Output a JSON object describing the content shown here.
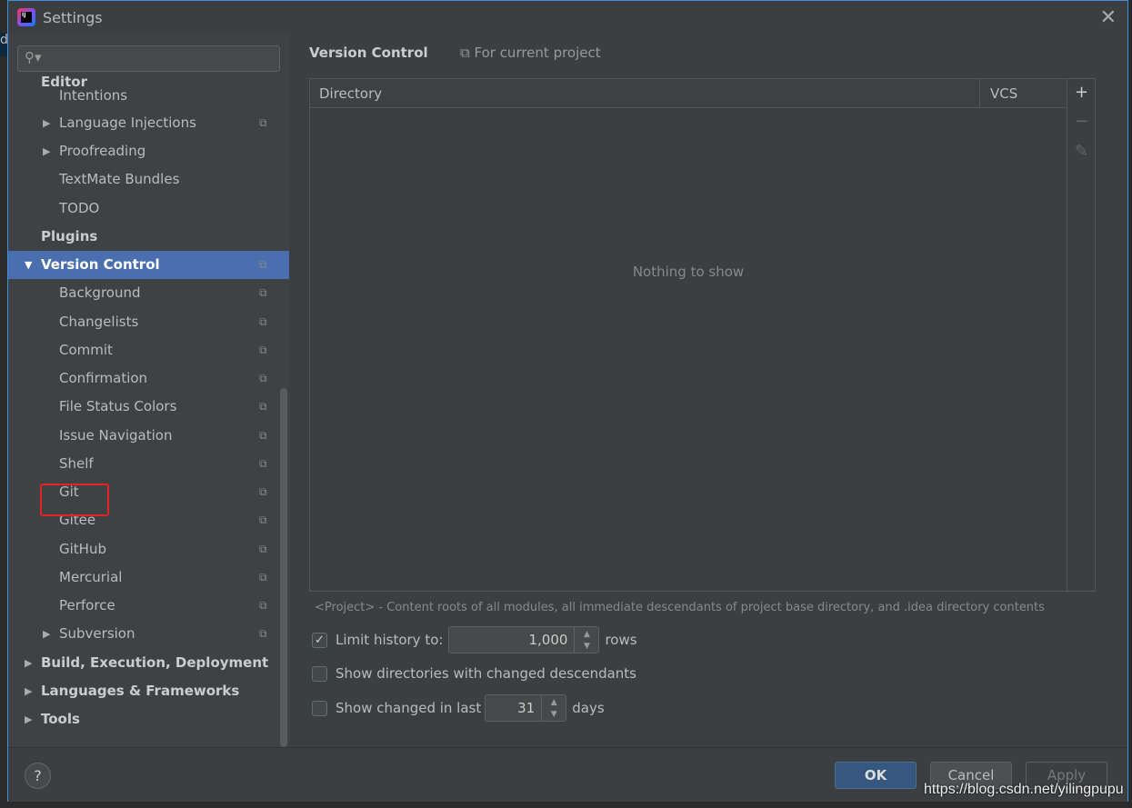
{
  "window": {
    "title": "Settings",
    "bg_partial": "d"
  },
  "sidebar": {
    "search_placeholder": "",
    "items": [
      {
        "label": "Editor",
        "level": 0,
        "bold": true
      },
      {
        "label": "Intentions",
        "level": 1
      },
      {
        "label": "Language Injections",
        "level": 1,
        "arrow": "▶",
        "copy": true
      },
      {
        "label": "Proofreading",
        "level": 1,
        "arrow": "▶"
      },
      {
        "label": "TextMate Bundles",
        "level": 1
      },
      {
        "label": "TODO",
        "level": 1
      },
      {
        "label": "Plugins",
        "level": 0,
        "bold": true
      },
      {
        "label": "Version Control",
        "level": 0,
        "bold": true,
        "arrow": "▼",
        "copy": true,
        "selected": true
      },
      {
        "label": "Background",
        "level": 1,
        "copy": true
      },
      {
        "label": "Changelists",
        "level": 1,
        "copy": true
      },
      {
        "label": "Commit",
        "level": 1,
        "copy": true
      },
      {
        "label": "Confirmation",
        "level": 1,
        "copy": true
      },
      {
        "label": "File Status Colors",
        "level": 1,
        "copy": true
      },
      {
        "label": "Issue Navigation",
        "level": 1,
        "copy": true
      },
      {
        "label": "Shelf",
        "level": 1,
        "copy": true
      },
      {
        "label": "Git",
        "level": 1,
        "copy": true
      },
      {
        "label": "Gitee",
        "level": 1,
        "copy": true,
        "highlighted": true
      },
      {
        "label": "GitHub",
        "level": 1,
        "copy": true
      },
      {
        "label": "Mercurial",
        "level": 1,
        "copy": true
      },
      {
        "label": "Perforce",
        "level": 1,
        "copy": true
      },
      {
        "label": "Subversion",
        "level": 1,
        "arrow": "▶",
        "copy": true
      },
      {
        "label": "Build, Execution, Deployment",
        "level": 0,
        "bold": true,
        "arrow": "▶"
      },
      {
        "label": "Languages & Frameworks",
        "level": 0,
        "bold": true,
        "arrow": "▶"
      },
      {
        "label": "Tools",
        "level": 0,
        "bold": true,
        "arrow": "▶"
      }
    ]
  },
  "main": {
    "title": "Version Control",
    "scope": "For current project",
    "table": {
      "columns": [
        "Directory",
        "VCS"
      ],
      "empty_text": "Nothing to show",
      "tools": [
        "+",
        "−",
        "✎"
      ]
    },
    "note": "<Project> - Content roots of all modules, all immediate descendants of project base directory, and .idea directory contents",
    "limit_history": {
      "checked": true,
      "label": "Limit history to:",
      "value": "1,000",
      "suffix": "rows"
    },
    "show_dirs": {
      "checked": false,
      "label": "Show directories with changed descendants"
    },
    "show_changed": {
      "checked": false,
      "label": "Show changed in last",
      "value": "31",
      "suffix": "days"
    }
  },
  "footer": {
    "help": "?",
    "ok": "OK",
    "cancel": "Cancel",
    "apply": "Apply"
  },
  "watermark": "https://blog.csdn.net/yilingpupu",
  "colors": {
    "selection": "#4b6eaf",
    "highlight_box": "#e62222",
    "accent_border": "#3d8fd6"
  }
}
